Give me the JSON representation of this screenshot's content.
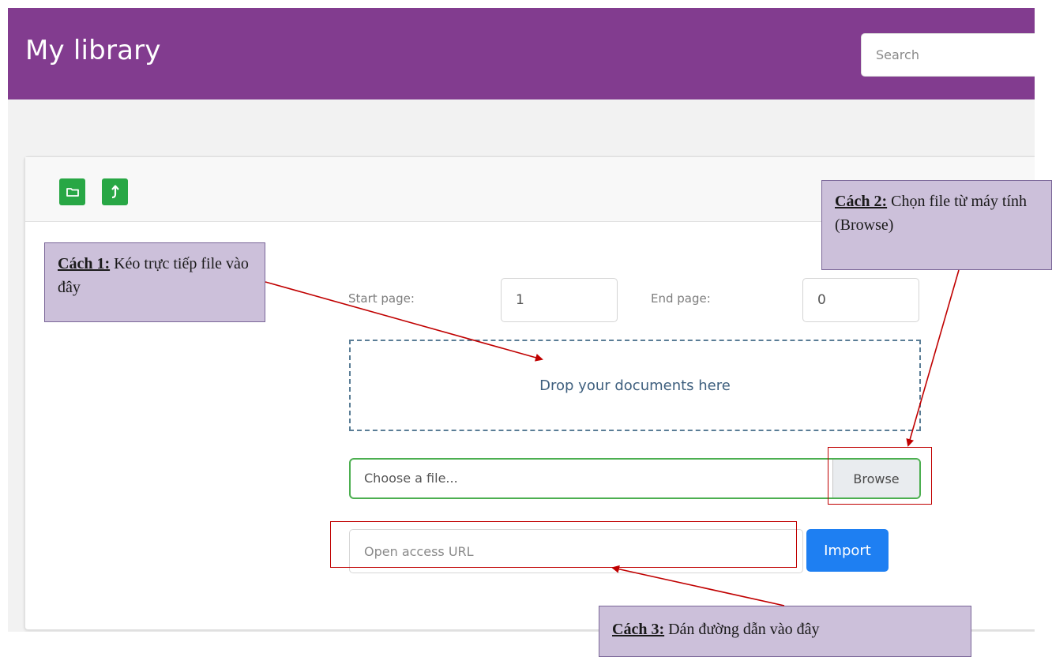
{
  "navbar": {
    "brand": "My library",
    "search_placeholder": "Search",
    "color": "#823c8f"
  },
  "toolbar": {
    "buttons": [
      {
        "icon": "folder-icon"
      },
      {
        "icon": "upload-arrow-icon"
      }
    ],
    "button_color": "#28a745"
  },
  "form": {
    "start_page_label": "Start page:",
    "start_page_value": "1",
    "end_page_label": "End page:",
    "end_page_value": "0",
    "dropzone_text": "Drop your documents here",
    "file_placeholder": "Choose a file...",
    "browse_label": "Browse",
    "url_placeholder": "Open access URL",
    "import_label": "Import",
    "import_color": "#1e7ff2"
  },
  "annotations": {
    "callout1": {
      "bold": "Cách 1:",
      "text": " Kéo trực tiếp file vào đây"
    },
    "callout2": {
      "bold": "Cách 2:",
      "text": " Chọn file từ máy tính (Browse)"
    },
    "callout3": {
      "bold": "Cách 3:",
      "text": " Dán đường dẫn vào đây"
    },
    "callout_color": "#ccc0da",
    "arrow_color": "#c00000"
  }
}
